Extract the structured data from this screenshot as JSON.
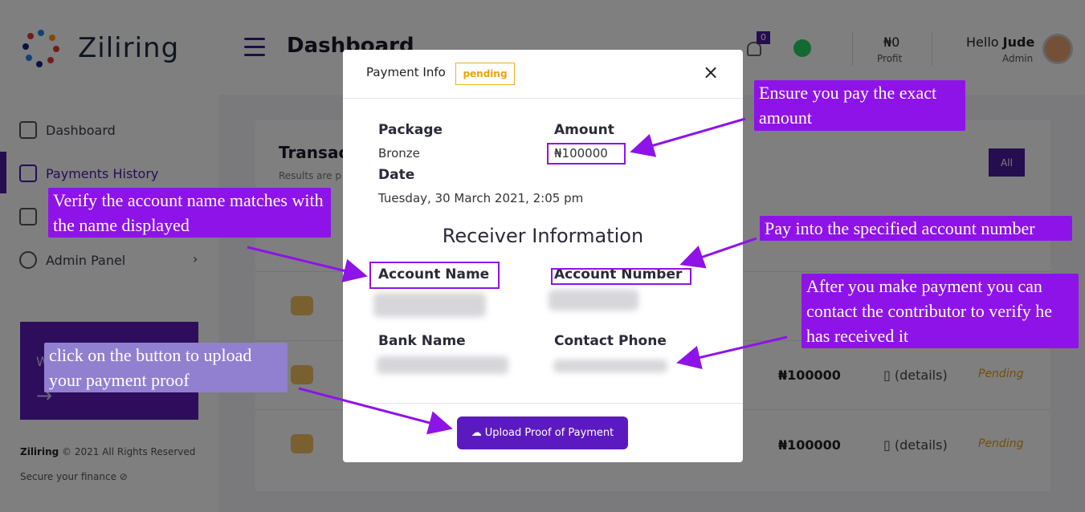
{
  "app": {
    "brand": "Ziliring",
    "page_title": "Dashboard"
  },
  "sidebar": {
    "items": [
      {
        "label": "Dashboard",
        "icon": "dashboard-icon"
      },
      {
        "label": "Payments History",
        "icon": "document-icon"
      },
      {
        "label": "",
        "icon": "layers-icon"
      },
      {
        "label": "Admin Panel",
        "icon": "globe-icon"
      }
    ],
    "promo_text": "W",
    "footer_brand": "Ziliring",
    "footer_rights": " © 2021 All Rights Reserved",
    "footer_secure": "Secure your finance ⊘"
  },
  "header": {
    "notification_count": "0",
    "profit_value": "₦0",
    "profit_label": "Profit",
    "hello_prefix": "Hello ",
    "user_name": "Jude",
    "user_role": "Admin"
  },
  "transactions": {
    "title": "Transac",
    "results_text": "Results are p",
    "filter_label": "All",
    "rows": [
      {
        "amount": "",
        "details": "",
        "status": ""
      },
      {
        "amount": "₦100000",
        "details": "(details)",
        "status": "Pending"
      },
      {
        "amount": "₦100000",
        "details": "(details)",
        "status": "Pending"
      }
    ]
  },
  "modal": {
    "title": "Payment Info",
    "status_badge": "pending",
    "close_symbol": "×",
    "package_label": "Package",
    "package_value": "Bronze",
    "amount_label": "Amount",
    "amount_value": "₦100000",
    "date_label": "Date",
    "date_value": "Tuesday, 30 March 2021, 2:05 pm",
    "receiver_heading": "Receiver Information",
    "account_name_label": "Account Name",
    "account_number_label": "Account Number",
    "bank_name_label": "Bank Name",
    "contact_phone_label": "Contact Phone",
    "upload_button": "Upload Proof of Payment"
  },
  "annotations": {
    "exact_amount": "Ensure you pay the exact amount",
    "verify_name": "Verify the account name matches with the name displayed",
    "account_number": "Pay into the specified account number",
    "contact": "After you make payment you can contact the contributor to verify he has received it",
    "upload": "click on the button to upload your payment proof"
  },
  "colors": {
    "brand_purple": "#4b1aa0",
    "button_purple": "#5b1ac0",
    "annotation_purple": "#8e13e8",
    "annotation_lilac": "#9180d0",
    "pending_amber": "#f0a010"
  }
}
